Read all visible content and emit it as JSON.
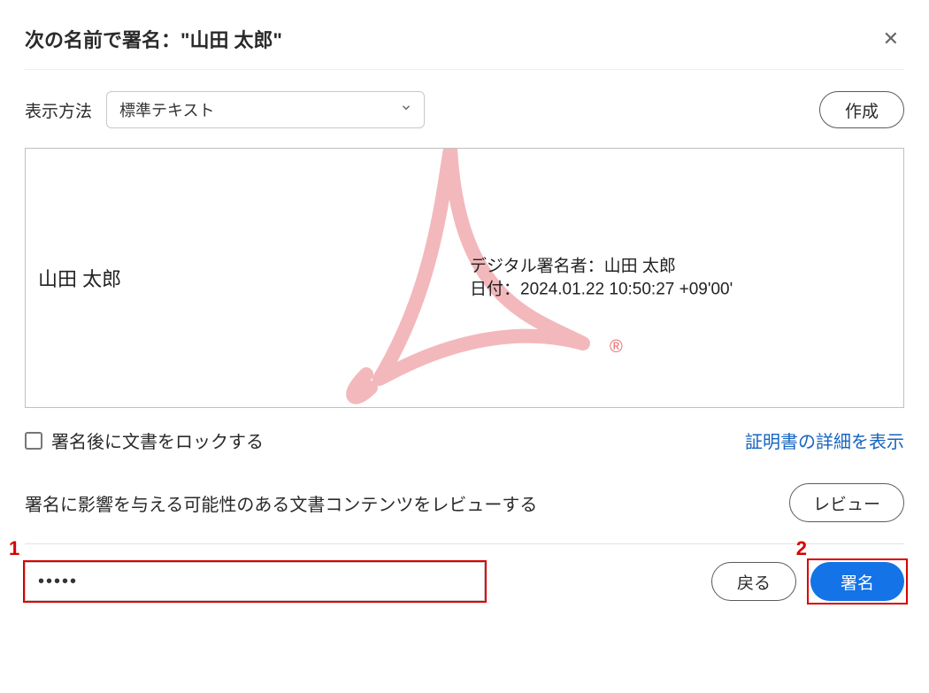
{
  "header": {
    "title_prefix": "次の名前で署名：",
    "title_name": "\"山田 太郎\""
  },
  "method": {
    "label": "表示方法",
    "selected": "標準テキスト",
    "create_button": "作成"
  },
  "preview": {
    "name": "山田 太郎",
    "signer_line": "デジタル署名者：山田 太郎",
    "date_line": "日付：2024.01.22 10:50:27 +09'00'"
  },
  "lock": {
    "label": "署名後に文書をロックする",
    "cert_link": "証明書の詳細を表示"
  },
  "review": {
    "text": "署名に影響を与える可能性のある文書コンテンツをレビューする",
    "button": "レビュー"
  },
  "footer": {
    "password_value": "•••••",
    "back_button": "戻る",
    "sign_button": "署名"
  },
  "annotations": {
    "label1": "1",
    "label2": "2"
  }
}
